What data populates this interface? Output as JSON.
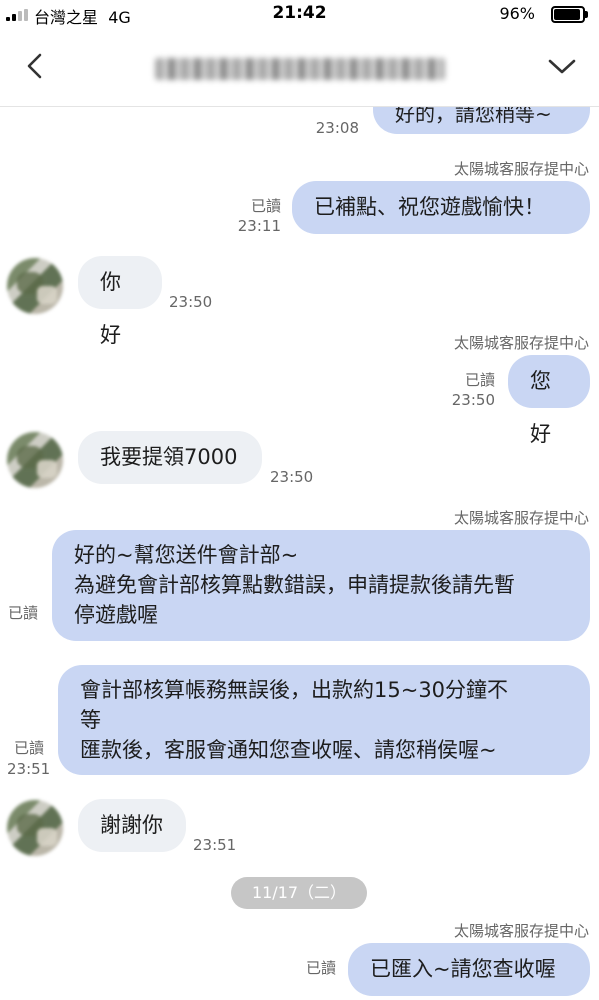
{
  "status_bar": {
    "carrier": "台灣之星",
    "network": "4G",
    "time": "21:42",
    "battery": "96%"
  },
  "header": {
    "back_icon": "chevron-left-icon",
    "menu_icon": "chevron-down-icon"
  },
  "messages": [
    {
      "id": "m0",
      "direction": "out",
      "text": "好的，請您稍等~",
      "time": "23:08"
    },
    {
      "id": "m1",
      "direction": "out",
      "sender": "太陽城客服存提中心",
      "read": "已讀",
      "text": "已補點、祝您遊戲愉快！",
      "time": "23:11"
    },
    {
      "id": "m2",
      "direction": "in",
      "text": "你好",
      "time": "23:50"
    },
    {
      "id": "m3",
      "direction": "out",
      "sender": "太陽城客服存提中心",
      "read": "已讀",
      "text": "您好",
      "time": "23:50"
    },
    {
      "id": "m4",
      "direction": "in",
      "text": "我要提領7000",
      "time": "23:50"
    },
    {
      "id": "m5",
      "direction": "out",
      "sender": "太陽城客服存提中心",
      "read": "已讀",
      "lines": [
        "好的~幫您送件會計部~",
        "為避免會計部核算點數錯誤，申請提款後請先暫",
        "停遊戲喔"
      ]
    },
    {
      "id": "m6",
      "direction": "out",
      "read": "已讀",
      "time": "23:51",
      "lines": [
        "會計部核算帳務無誤後，出款約15~30分鐘不",
        "等",
        "匯款後，客服會通知您查收喔、請您稍侯喔~"
      ]
    },
    {
      "id": "m7",
      "direction": "in",
      "text": "謝謝你",
      "time": "23:51"
    },
    {
      "id": "m8",
      "direction": "out",
      "sender": "太陽城客服存提中心",
      "read": "已讀",
      "text": "已匯入~請您查收喔"
    }
  ],
  "date_divider": "11/17（二）",
  "colors": {
    "outgoing_bubble": "#c9d6f3",
    "incoming_bubble": "#edf0f4",
    "date_pill": "#c6c6c6"
  }
}
